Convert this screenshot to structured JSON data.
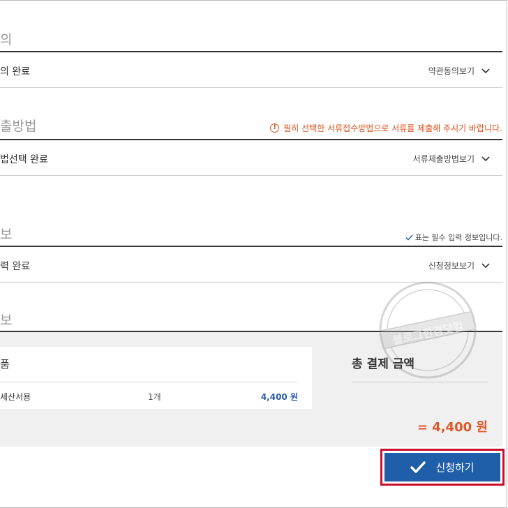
{
  "sections": {
    "terms": {
      "title": "의",
      "row_label": "의 완료",
      "toggle_label": "약관동의보기"
    },
    "submission": {
      "title": "출방법",
      "notice": "필히 선택한 서류접수방법으로 서류를 제출해 주시기 바랍니다.",
      "row_label": "법선택 완료",
      "toggle_label": "서류제출방법보기"
    },
    "info": {
      "title": "보",
      "required_note": "표는 필수 입력 정보입니다.",
      "row_label": "력 완료",
      "toggle_label": "신청정보보기"
    },
    "payment": {
      "title": "보"
    }
  },
  "product": {
    "title": "품",
    "name": "세산서용",
    "quantity": "1개",
    "price": "4,400 원"
  },
  "total": {
    "label": "총 결제 금액",
    "amount": "= 4,400 원"
  },
  "submit": {
    "label": "신청하기"
  },
  "watermark": {
    "text": "블로그한경닷컴"
  },
  "colors": {
    "accent_blue": "#1f5ea8",
    "notice_orange": "#d9531e",
    "total_orange": "#e0572a",
    "highlight_red": "#c8102e"
  },
  "icons": [
    "chevron-down-icon",
    "info-circle-icon",
    "check-icon"
  ]
}
